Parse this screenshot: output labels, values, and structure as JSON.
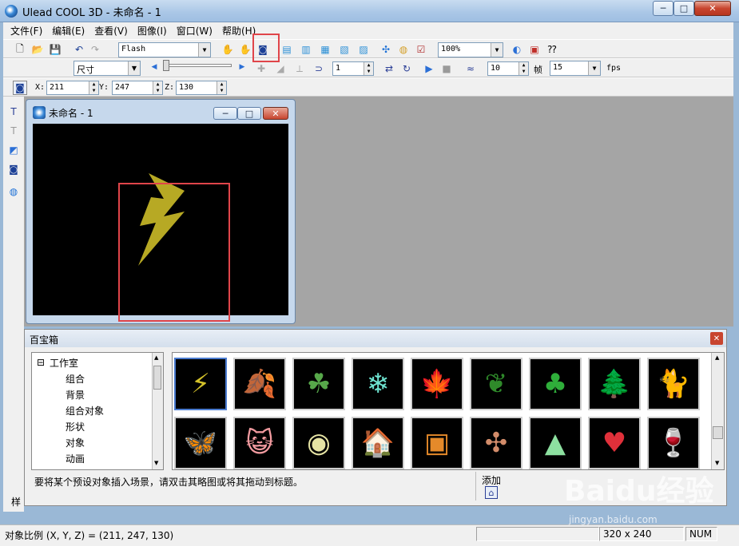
{
  "window": {
    "title": "Ulead COOL 3D - 未命名 - 1",
    "icon": "app-globe-icon",
    "controls": {
      "minimize": "─",
      "maximize": "□",
      "close": "✕"
    }
  },
  "menu": [
    {
      "label": "文件(F)"
    },
    {
      "label": "编辑(E)"
    },
    {
      "label": "查看(V)"
    },
    {
      "label": "图像(I)"
    },
    {
      "label": "窗口(W)"
    },
    {
      "label": "帮助(H)"
    }
  ],
  "toolbar1": {
    "format": "Flash",
    "zoom": "100%"
  },
  "toolbar2": {
    "attribute": "尺寸",
    "frame": "1",
    "frame_rate": "10",
    "frames_label": "帧",
    "fps_value": "15",
    "fps_label": "fps"
  },
  "toolbar3": {
    "x_label": "X:",
    "x_value": "211",
    "y_label": "Y:",
    "y_value": "247",
    "z_label": "Z:",
    "z_value": "130"
  },
  "document": {
    "title": "未命名 - 1",
    "controls": {
      "minimize": "─",
      "maximize": "□",
      "close": "✕"
    }
  },
  "easy_palette": {
    "title": "百宝箱",
    "close": "✕",
    "tree": [
      {
        "label": "工作室"
      },
      {
        "label": "组合"
      },
      {
        "label": "背景"
      },
      {
        "label": "组合对象"
      },
      {
        "label": "形状"
      },
      {
        "label": "对象"
      },
      {
        "label": "动画"
      }
    ],
    "thumbnails": [
      {
        "icon": "lightning-bolt-icon",
        "glyph": "⚡",
        "color": "#d4c22a"
      },
      {
        "icon": "autumn-leaf-icon",
        "glyph": "🍂",
        "color": "#e79a3a"
      },
      {
        "icon": "shamrock-icon",
        "glyph": "☘",
        "color": "#57a84a"
      },
      {
        "icon": "snowflake-icon",
        "glyph": "❄",
        "color": "#6ee3d0"
      },
      {
        "icon": "maple-leaf-icon",
        "glyph": "🍁",
        "color": "#e0652a"
      },
      {
        "icon": "holly-icon",
        "glyph": "❦",
        "color": "#2f8a2a"
      },
      {
        "icon": "clover-icon",
        "glyph": "♣",
        "color": "#2fae3a"
      },
      {
        "icon": "tree-icon",
        "glyph": "🌲",
        "color": "#2fb33a"
      },
      {
        "icon": "cat-icon",
        "glyph": "🐈",
        "color": "#e0b479"
      },
      {
        "icon": "butterfly-icon",
        "glyph": "🦋",
        "color": "#f0a13a"
      },
      {
        "icon": "cat-face-icon",
        "glyph": "😺",
        "color": "#f29ba0"
      },
      {
        "icon": "disc-icon",
        "glyph": "◉",
        "color": "#e6e4a4"
      },
      {
        "icon": "house-icon",
        "glyph": "🏠",
        "color": "#d4c7a8"
      },
      {
        "icon": "cat-frame-icon",
        "glyph": "▣",
        "color": "#e58a2a"
      },
      {
        "icon": "puzzle-icon",
        "glyph": "✣",
        "color": "#d28c6a"
      },
      {
        "icon": "sail-icon",
        "glyph": "▲",
        "color": "#8de0a0"
      },
      {
        "icon": "heart-arrow-icon",
        "glyph": "♥",
        "color": "#e0303a"
      },
      {
        "icon": "wine-glass-icon",
        "glyph": "🍷",
        "color": "#c9f3f0"
      }
    ],
    "hint": "要将某个预设对象插入场景，请双击其略图或将其拖动到标题。",
    "add_label": "添加",
    "side_tab": "样"
  },
  "status": {
    "text": "对象比例 (X, Y, Z) = (211, 247, 130)",
    "size": "320 x 240",
    "num": "NUM"
  },
  "watermark": {
    "text": "Baidu经验",
    "sub": "jingyan.baidu.com"
  }
}
